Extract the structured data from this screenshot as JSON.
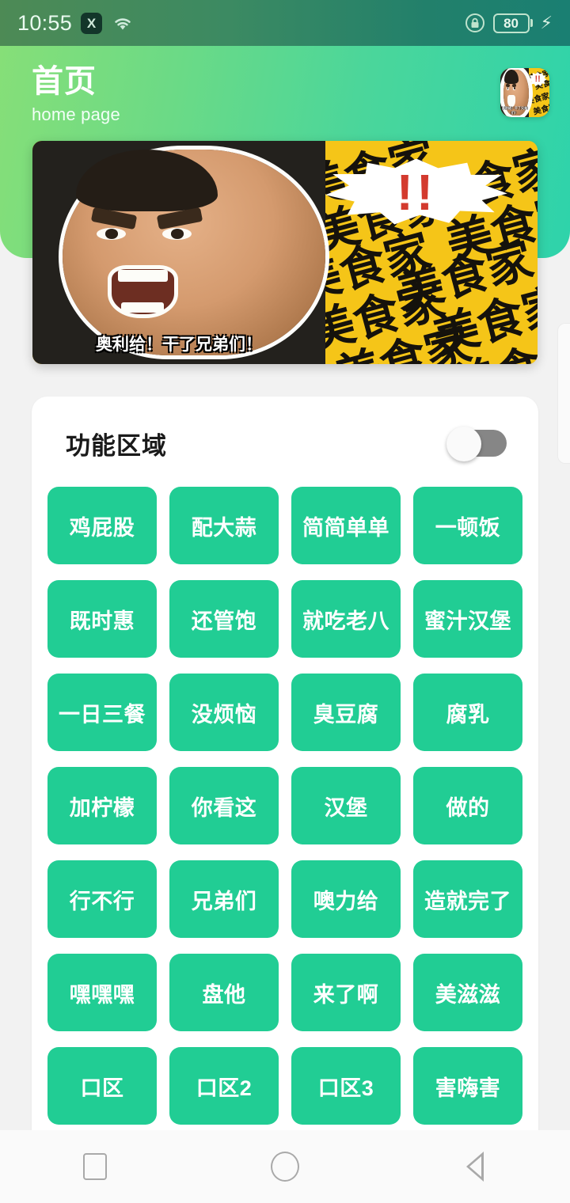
{
  "statusbar": {
    "time": "10:55",
    "x_icon_label": "X",
    "wifi_icon": "wifi-icon",
    "lock_icon": "rotation-lock-icon",
    "battery_level": "80",
    "charging_icon": "⚡"
  },
  "header": {
    "title": "首页",
    "subtitle": "home page",
    "avatar_name": "user-avatar"
  },
  "banner": {
    "caption": "奥利给！干了兄弟们！",
    "pattern_text": "美食家",
    "burst_text": "!!",
    "alt": "meme-banner"
  },
  "card": {
    "title": "功能区域",
    "toggle": {
      "name": "feature-area-toggle",
      "state": "off"
    },
    "chips": [
      "鸡屁股",
      "配大蒜",
      "简简单单",
      "一顿饭",
      "既时惠",
      "还管饱",
      "就吃老八",
      "蜜汁汉堡",
      "一日三餐",
      "没烦恼",
      "臭豆腐",
      "腐乳",
      "加柠檬",
      "你看这",
      "汉堡",
      "做的",
      "行不行",
      "兄弟们",
      "噢力给",
      "造就完了",
      "嘿嘿嘿",
      "盘他",
      "来了啊",
      "美滋滋",
      "口区",
      "口区2",
      "口区3",
      "害嗨害"
    ]
  },
  "navbar": {
    "recents_label": "recents",
    "home_label": "home",
    "back_label": "back"
  },
  "colors": {
    "accent_green": "#21cd94",
    "header_gradient_start": "#86df78",
    "header_gradient_end": "#2ed3ab",
    "page_background": "#f2f2f2",
    "card_background": "#ffffff",
    "banner_yellow": "#f5c518"
  }
}
